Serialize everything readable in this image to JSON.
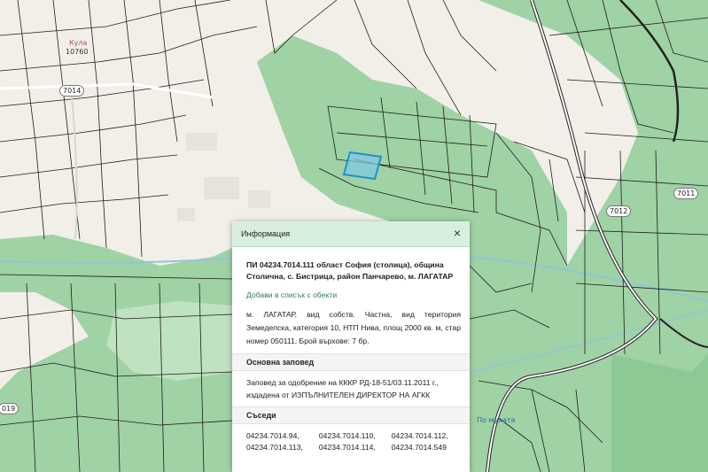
{
  "map": {
    "road_badges": [
      "7014",
      "7011",
      "7012",
      "019"
    ],
    "place_labels": [
      "Кула",
      "10760"
    ],
    "poi_label": "По мухата",
    "colors": {
      "background": "#f1efe8",
      "forest": "#9fd2a4",
      "parcel_line": "#1d1d1d",
      "selected_parcel": "#7fc7e6",
      "selected_outline": "#1c92cc",
      "river": "#8ec7d8"
    }
  },
  "info_panel": {
    "title": "Информация",
    "close_icon": "×",
    "parcel_title": "ПИ 04234.7014.111 област София (столица), община Столична, с. Бистрица, район Панчарево, м. ЛАГАТАР",
    "add_link": "Добави в списък с обекти",
    "details": "м. ЛАГАТАР, вид собств. Частна, вид територия Земеделска, категория 10, НТП Нива, площ 2000 кв. м, стар номер 050111, Брой върхове: 7 бр.",
    "order_heading": "Основна заповед",
    "order_text": "Заповед за одобрение на КККР РД-18-51/03.11.2011 г., издадена от ИЗПЪЛНИТЕЛЕН ДИРЕКТОР НА АГКК",
    "neighbors_heading": "Съседи",
    "neighbors": [
      "04234.7014.94,",
      "04234.7014.110,",
      "04234.7014.112,",
      "04234.7014.113,",
      "04234.7014.114,",
      "04234.7014.549"
    ]
  }
}
